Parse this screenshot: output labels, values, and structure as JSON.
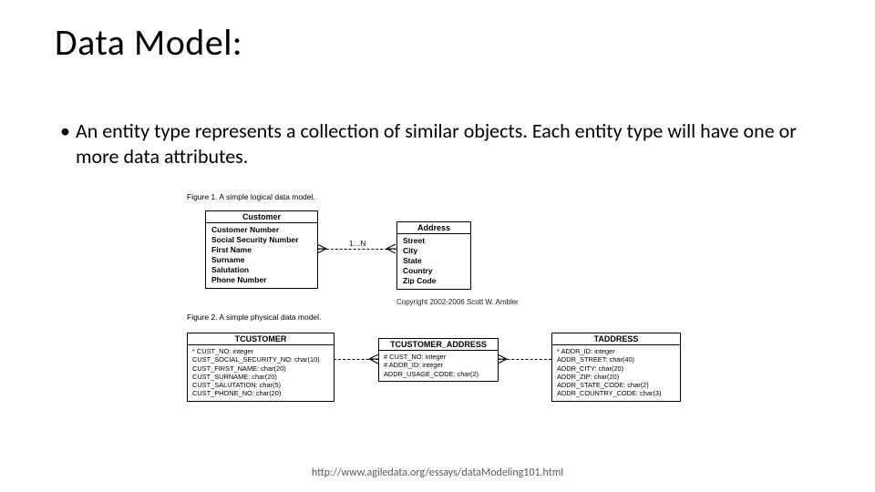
{
  "title": "Data Model:",
  "bullet": "An entity type represents a collection of similar objects. Each entity type will have one or more data attributes.",
  "fig1": {
    "caption": "Figure 1. A simple logical data model.",
    "customer": {
      "title": "Customer",
      "attrs": [
        "Customer Number",
        "Social Security Number",
        "First Name",
        "Surname",
        "Salutation",
        "Phone Number"
      ]
    },
    "address": {
      "title": "Address",
      "attrs": [
        "Street",
        "City",
        "State",
        "Country",
        "Zip Code"
      ]
    },
    "notation": "1…N",
    "copyright": "Copyright 2002-2006 Scott W. Ambler"
  },
  "fig2": {
    "caption": "Figure 2. A simple physical data model.",
    "tcustomer": {
      "title": "TCUSTOMER",
      "attrs": [
        "* CUST_NO: integer",
        "CUST_SOCIAL_SECURITY_NO: char(10)",
        "CUST_FIRST_NAME: char(20)",
        "CUST_SURNAME: char(20)",
        "CUST_SALUTATION: char(5)",
        "CUST_PHONE_NO: char(20)"
      ]
    },
    "tcustaddr": {
      "title": "TCUSTOMER_ADDRESS",
      "attrs": [
        "# CUST_NO: integer",
        "# ADDR_ID: integer",
        "ADDR_USAGE_CODE: char(2)"
      ]
    },
    "taddress": {
      "title": "TADDRESS",
      "attrs": [
        "* ADDR_ID: integer",
        "ADDR_STREET: char(40)",
        "ADDR_CITY: char(20)",
        "ADDR_ZIP: char(20)",
        "ADDR_STATE_CODE: char(2)",
        "ADDR_COUNTRY_CODE: char(3)"
      ]
    }
  },
  "footer_url": "http://www.agiledata.org/essays/dataModeling101.html"
}
